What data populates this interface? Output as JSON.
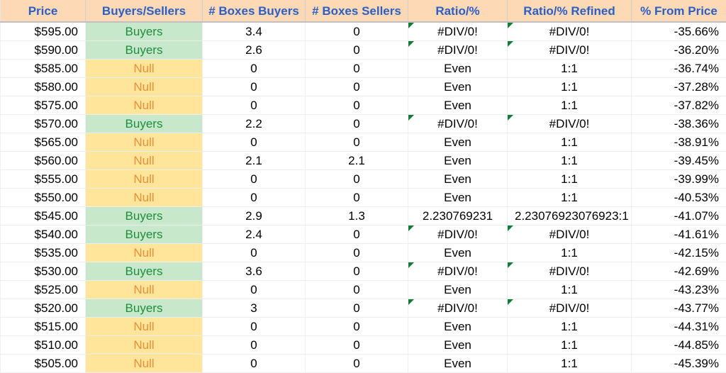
{
  "columns": {
    "price": "Price",
    "bs": "Buyers/Sellers",
    "boxes_buyers": "# Boxes Buyers",
    "boxes_sellers": "# Boxes Sellers",
    "ratio": "Ratio/%",
    "ratio_refined": "Ratio/% Refined",
    "from_price": "% From Price"
  },
  "rows": [
    {
      "price": "$595.00",
      "bs": "Buyers",
      "bb": "3.4",
      "bseller": "0",
      "ratio": "#DIV/0!",
      "ratio_err": true,
      "refined": "#DIV/0!",
      "refined_err": true,
      "from": "-35.66%"
    },
    {
      "price": "$590.00",
      "bs": "Buyers",
      "bb": "2.6",
      "bseller": "0",
      "ratio": "#DIV/0!",
      "ratio_err": true,
      "refined": "#DIV/0!",
      "refined_err": true,
      "from": "-36.20%"
    },
    {
      "price": "$585.00",
      "bs": "Null",
      "bb": "0",
      "bseller": "0",
      "ratio": "Even",
      "ratio_err": false,
      "refined": "1:1",
      "refined_err": false,
      "from": "-36.74%"
    },
    {
      "price": "$580.00",
      "bs": "Null",
      "bb": "0",
      "bseller": "0",
      "ratio": "Even",
      "ratio_err": false,
      "refined": "1:1",
      "refined_err": false,
      "from": "-37.28%"
    },
    {
      "price": "$575.00",
      "bs": "Null",
      "bb": "0",
      "bseller": "0",
      "ratio": "Even",
      "ratio_err": false,
      "refined": "1:1",
      "refined_err": false,
      "from": "-37.82%"
    },
    {
      "price": "$570.00",
      "bs": "Buyers",
      "bb": "2.2",
      "bseller": "0",
      "ratio": "#DIV/0!",
      "ratio_err": true,
      "refined": "#DIV/0!",
      "refined_err": true,
      "from": "-38.36%"
    },
    {
      "price": "$565.00",
      "bs": "Null",
      "bb": "0",
      "bseller": "0",
      "ratio": "Even",
      "ratio_err": false,
      "refined": "1:1",
      "refined_err": false,
      "from": "-38.91%"
    },
    {
      "price": "$560.00",
      "bs": "Null",
      "bb": "2.1",
      "bseller": "2.1",
      "ratio": "Even",
      "ratio_err": false,
      "refined": "1:1",
      "refined_err": false,
      "from": "-39.45%"
    },
    {
      "price": "$555.00",
      "bs": "Null",
      "bb": "0",
      "bseller": "0",
      "ratio": "Even",
      "ratio_err": false,
      "refined": "1:1",
      "refined_err": false,
      "from": "-39.99%"
    },
    {
      "price": "$550.00",
      "bs": "Null",
      "bb": "0",
      "bseller": "0",
      "ratio": "Even",
      "ratio_err": false,
      "refined": "1:1",
      "refined_err": false,
      "from": "-40.53%"
    },
    {
      "price": "$545.00",
      "bs": "Buyers",
      "bb": "2.9",
      "bseller": "1.3",
      "ratio": "2.230769231",
      "ratio_err": false,
      "refined": "2.23076923076923:1",
      "refined_err": false,
      "from": "-41.07%"
    },
    {
      "price": "$540.00",
      "bs": "Buyers",
      "bb": "2.4",
      "bseller": "0",
      "ratio": "#DIV/0!",
      "ratio_err": true,
      "refined": "#DIV/0!",
      "refined_err": true,
      "from": "-41.61%"
    },
    {
      "price": "$535.00",
      "bs": "Null",
      "bb": "0",
      "bseller": "0",
      "ratio": "Even",
      "ratio_err": false,
      "refined": "1:1",
      "refined_err": false,
      "from": "-42.15%"
    },
    {
      "price": "$530.00",
      "bs": "Buyers",
      "bb": "3.6",
      "bseller": "0",
      "ratio": "#DIV/0!",
      "ratio_err": true,
      "refined": "#DIV/0!",
      "refined_err": true,
      "from": "-42.69%"
    },
    {
      "price": "$525.00",
      "bs": "Null",
      "bb": "0",
      "bseller": "0",
      "ratio": "Even",
      "ratio_err": false,
      "refined": "1:1",
      "refined_err": false,
      "from": "-43.23%"
    },
    {
      "price": "$520.00",
      "bs": "Buyers",
      "bb": "3",
      "bseller": "0",
      "ratio": "#DIV/0!",
      "ratio_err": true,
      "refined": "#DIV/0!",
      "refined_err": true,
      "from": "-43.77%"
    },
    {
      "price": "$515.00",
      "bs": "Null",
      "bb": "0",
      "bseller": "0",
      "ratio": "Even",
      "ratio_err": false,
      "refined": "1:1",
      "refined_err": false,
      "from": "-44.31%"
    },
    {
      "price": "$510.00",
      "bs": "Null",
      "bb": "0",
      "bseller": "0",
      "ratio": "Even",
      "ratio_err": false,
      "refined": "1:1",
      "refined_err": false,
      "from": "-44.85%"
    },
    {
      "price": "$505.00",
      "bs": "Null",
      "bb": "0",
      "bseller": "0",
      "ratio": "Even",
      "ratio_err": false,
      "refined": "1:1",
      "refined_err": false,
      "from": "-45.39%"
    }
  ]
}
